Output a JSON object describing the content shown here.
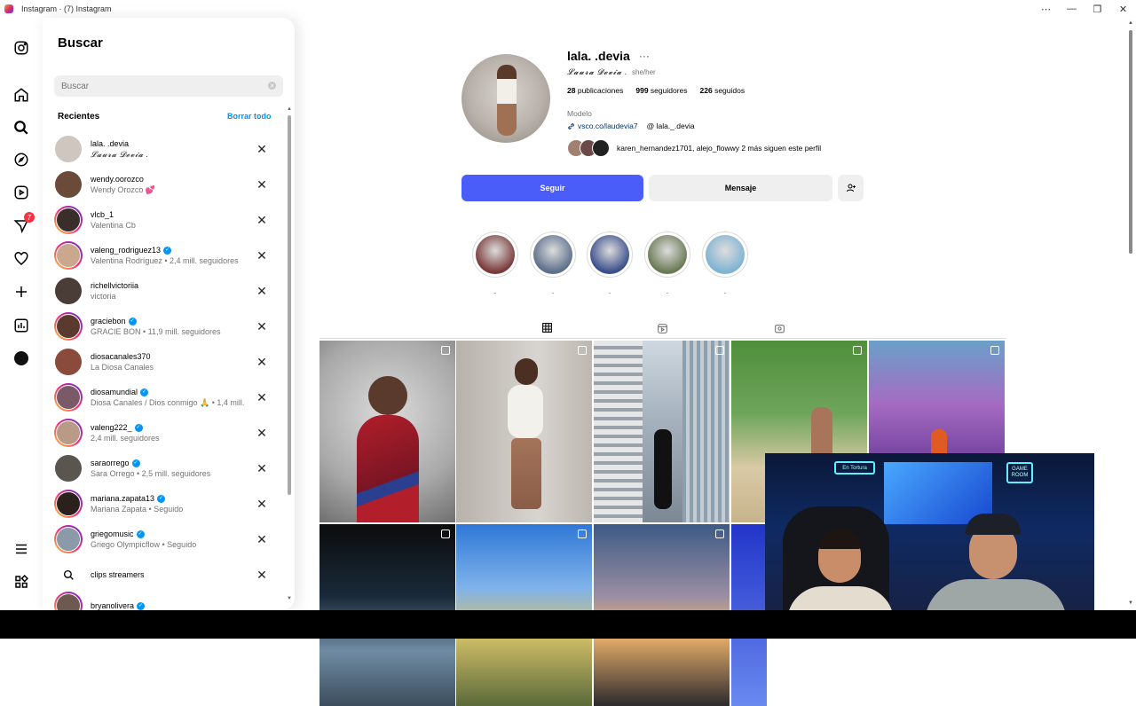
{
  "window": {
    "title": "Instagram · (7) Instagram",
    "controls": [
      "⋯",
      "—",
      "❐",
      "✕"
    ]
  },
  "nav": {
    "notification_count": "7"
  },
  "search": {
    "title": "Buscar",
    "placeholder": "Buscar",
    "recent_label": "Recientes",
    "clear_all": "Borrar todo",
    "items": [
      {
        "username": "lala. .devia",
        "subtitle": "𝓛𝓪𝓾𝓻𝓪 𝓓𝓮𝓿𝓲𝓪 .",
        "script": true,
        "verified": false,
        "ring": false,
        "avatar": "#cfc6bf"
      },
      {
        "username": "wendy.oorozco",
        "subtitle": "Wendy Orozco 💕",
        "verified": false,
        "ring": false,
        "avatar": "#6b4a3a"
      },
      {
        "username": "vlcb_1",
        "subtitle": "Valentina Cb",
        "verified": false,
        "ring": true,
        "avatar": "#3a2e2a"
      },
      {
        "username": "valeng_rodriguez13",
        "subtitle": "Valentina Rodríguez • 2,4 mill. seguidores",
        "verified": true,
        "ring": true,
        "avatar": "#c9a88e"
      },
      {
        "username": "richellvictoriia",
        "subtitle": "victoria",
        "verified": false,
        "ring": false,
        "avatar": "#4a3c36"
      },
      {
        "username": "graciebon",
        "subtitle": "GRACIE BON • 11,9 mill. seguidores",
        "verified": true,
        "ring": true,
        "avatar": "#5a3a2e"
      },
      {
        "username": "diosacanales370",
        "subtitle": "La Diosa Canales",
        "verified": false,
        "ring": false,
        "avatar": "#8a4a3c"
      },
      {
        "username": "diosamundial",
        "subtitle": "Diosa Canales / Dios conmigo 🙏 • 1,4 mill.",
        "verified": true,
        "ring": true,
        "avatar": "#7a5a66"
      },
      {
        "username": "valeng222_",
        "subtitle": "2,4 mill. seguidores",
        "verified": true,
        "ring": true,
        "avatar": "#b99a86"
      },
      {
        "username": "saraorrego",
        "subtitle": "Sara Orrego • 2,5 mill. seguidores",
        "verified": true,
        "ring": false,
        "avatar": "#5b5550"
      },
      {
        "username": "mariana.zapata13",
        "subtitle": "Mariana Zapata • Seguido",
        "verified": true,
        "ring": true,
        "avatar": "#2a201c"
      },
      {
        "username": "griegomusic",
        "subtitle": "Griego Olympicflow • Seguido",
        "verified": true,
        "ring": true,
        "avatar": "#8a9aa8"
      }
    ],
    "keyword_item": "clips streamers",
    "partial_item": "bryanolivera"
  },
  "profile": {
    "username": "lala. .devia",
    "more": "···",
    "full_name": "𝓛𝓪𝓾𝓻𝓪 𝓓𝓮𝓿𝓲𝓪 .",
    "pronouns": "she/her",
    "posts_count": "28",
    "posts_label": "publicaciones",
    "followers_count": "999",
    "followers_label": "seguidores",
    "following_count": "226",
    "following_label": "seguidos",
    "category": "Modelo",
    "link": "vsco.co/laudevia7",
    "threads": "lala._.devia",
    "followed_by_names": "karen_hernandez1701, alejo_floww",
    "followed_by_rest": " y 2 más siguen este perfil",
    "follow_button": "Seguir",
    "message_button": "Mensaje",
    "highlights": [
      {
        "label": ".",
        "color": "#7a3a3a"
      },
      {
        "label": ".",
        "color": "#5c6f8c"
      },
      {
        "label": ".",
        "color": "#3b4f8a"
      },
      {
        "label": ".",
        "color": "#6a7a54"
      },
      {
        "label": ".",
        "color": "#7fb3d2"
      }
    ]
  },
  "cam_overlay": {
    "sign1": "En Tortura",
    "sign2": "GAME ROOM"
  }
}
